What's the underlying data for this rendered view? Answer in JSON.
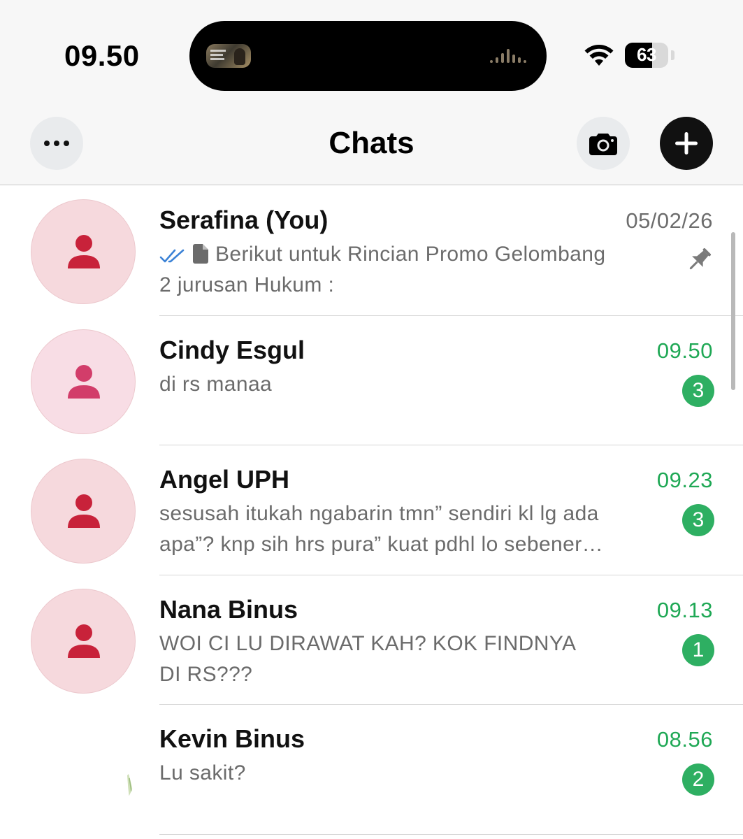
{
  "status_bar": {
    "time": "09.50",
    "battery_percent": "63",
    "battery_level": 0.63
  },
  "nav": {
    "title": "Chats",
    "more_icon": "ellipsis-icon",
    "camera_icon": "camera-icon",
    "new_chat_icon": "plus-icon"
  },
  "chats": [
    {
      "name": "Serafina (You)",
      "time": "05/02/26",
      "preview_line1": "Berikut untuk Rincian Promo Gelombang",
      "preview_line2": "2 jurusan Hukum :",
      "unread": "",
      "pinned": true,
      "read_ticks": true,
      "doc_icon": true
    },
    {
      "name": "Cindy Esgul",
      "time": "09.50",
      "preview_line1": "di rs manaa",
      "preview_line2": "",
      "unread": "3"
    },
    {
      "name": "Angel UPH",
      "time": "09.23",
      "preview_line1": "sesusah itukah ngabarin tmn” sendiri kl lg ada",
      "preview_line2": "apa”? knp sih hrs pura” kuat pdhl lo sebener…",
      "unread": "3"
    },
    {
      "name": "Nana Binus",
      "time": "09.13",
      "preview_line1": "WOI CI LU DIRAWAT KAH? KOK FINDNYA",
      "preview_line2": "DI RS???",
      "unread": "1"
    },
    {
      "name": "Kevin Binus",
      "time": "08.56",
      "preview_line1": "Lu sakit?",
      "preview_line2": "",
      "unread": "2"
    }
  ],
  "colors": {
    "unread_green": "#1fa855",
    "badge_green": "#2eaf62",
    "avatar_person_red": "#c8223a",
    "avatar_person_pink": "#d23d6a",
    "read_tick_blue": "#3b82d6"
  }
}
